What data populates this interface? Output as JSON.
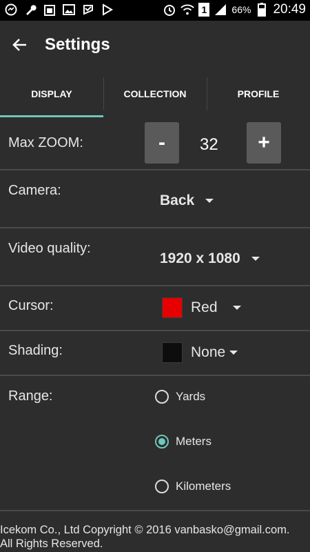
{
  "status_bar": {
    "battery": "66%",
    "sim_badge": "1",
    "time": "20:49",
    "icons_left": [
      "messenger-icon",
      "wrench-icon",
      "calendar-icon",
      "gallery-icon",
      "check-flag-icon",
      "play-store-icon"
    ],
    "icons_right": [
      "alarm-icon",
      "wifi-icon",
      "sim-icon",
      "signal-icon",
      "battery-icon"
    ]
  },
  "app_bar": {
    "title": "Settings",
    "back_icon": "arrow-left-icon"
  },
  "tabs": [
    {
      "label": "DISPLAY",
      "active": true
    },
    {
      "label": "COLLECTION",
      "active": false
    },
    {
      "label": "PROFILE",
      "active": false
    }
  ],
  "settings": {
    "max_zoom": {
      "label": "Max ZOOM:",
      "decrement": "-",
      "increment": "+",
      "value": "32"
    },
    "camera": {
      "label": "Camera:",
      "value": "Back"
    },
    "video_quality": {
      "label": "Video quality:",
      "value": "1920 x 1080"
    },
    "cursor": {
      "label": "Cursor:",
      "value": "Red",
      "color": "#e60000"
    },
    "shading": {
      "label": "Shading:",
      "value": "None",
      "color": "#0d0d0d"
    },
    "range": {
      "label": "Range:",
      "options": [
        {
          "label": "Yards",
          "selected": false
        },
        {
          "label": "Meters",
          "selected": true
        },
        {
          "label": "Kilometers",
          "selected": false
        }
      ]
    }
  },
  "footer": {
    "line1": "Icekom Co., Ltd Copyright © 2016 vanbasko@gmail.com.",
    "line2": "All Rights Reserved."
  },
  "colors": {
    "accent": "#70c7bb",
    "background": "#2d2d2d",
    "button": "#5a5a5a"
  }
}
